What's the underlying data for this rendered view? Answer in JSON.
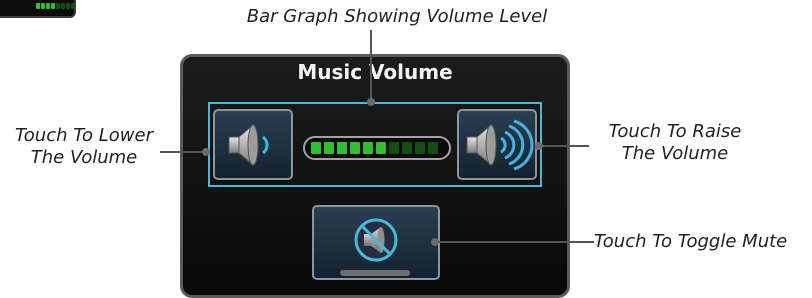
{
  "panel": {
    "title": "Music Volume"
  },
  "callouts": {
    "bar_graph": "Bar Graph Showing Volume Level",
    "lower_line1": "Touch To Lower",
    "lower_line2": "The Volume",
    "raise_line1": "Touch To Raise",
    "raise_line2": "The Volume",
    "mute": "Touch To Toggle Mute"
  },
  "volume": {
    "level": 6,
    "max": 10
  },
  "mini_indicator": {
    "level": 4,
    "max": 8
  },
  "colors": {
    "segment_on": "#2ec02e",
    "segment_off": "#134f13",
    "accent_frame": "#4cb7d8",
    "button_face": "#1d2e3d"
  },
  "icons": {
    "lower": "speaker-low-icon",
    "raise": "speaker-high-icon",
    "mute": "speaker-mute-icon"
  }
}
